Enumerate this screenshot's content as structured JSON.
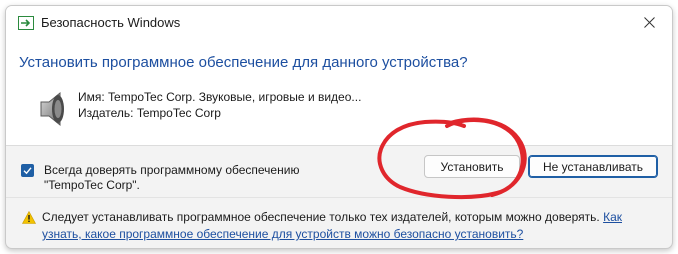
{
  "window": {
    "title": "Безопасность Windows"
  },
  "dialog": {
    "heading": "Установить программное обеспечение для данного устройства?",
    "device": {
      "name_line": "Имя: TempoTec Corp. Звуковые, игровые и видео...",
      "publisher_line": "Издатель: TempoTec Corp"
    },
    "trust_checkbox": {
      "checked": true,
      "label_line1": "Всегда доверять программному обеспечению",
      "label_line2": "\"TempoTec Corp\"."
    },
    "buttons": {
      "install": "Установить",
      "dont_install": "Не устанавливать"
    },
    "warning": {
      "text": "Следует устанавливать программное обеспечение только тех издателей, которым можно доверять.",
      "link": "Как узнать, какое программное обеспечение для устройств можно безопасно установить?"
    }
  },
  "icons": {
    "app": "security-shield-icon",
    "close": "close-icon",
    "device": "speaker-icon",
    "checkbox": "checkmark-icon",
    "warning": "warning-shield-icon"
  },
  "colors": {
    "accent": "#1f5fa5",
    "heading": "#1d4fa0",
    "annotation": "#e0262c",
    "warning": "#f2c200"
  }
}
